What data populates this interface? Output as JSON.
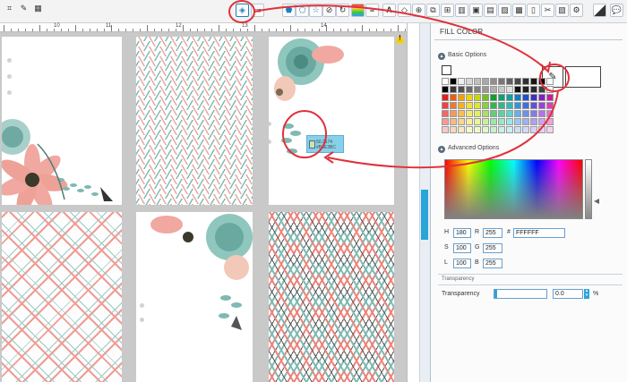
{
  "toolbar": {
    "icons": [
      "crop-tool-icon",
      "trace-tool-icon",
      "grid-tool-icon",
      "fill-color-icon",
      "line-color-icon",
      "pentagon-icon",
      "heptagon-icon",
      "star-icon",
      "knife-icon",
      "rotate-icon",
      "gradient-icon",
      "line-style-icon",
      "text-icon",
      "point-edit-icon",
      "offset-icon",
      "replicate-icon",
      "weld-icon",
      "align-icon",
      "group-icon",
      "image-icon",
      "library-icon",
      "store-icon",
      "page-setup-icon",
      "cut-settings-icon",
      "send-icon",
      "print-icon"
    ],
    "fill_icon_color": "#1f7ec2"
  },
  "ruler": {
    "top_labels": [
      "10",
      "11",
      "12",
      "13",
      "14"
    ]
  },
  "warning_symbol": "!",
  "tooltip": {
    "line1": "50.2174",
    "line2": "#B9E3BC"
  },
  "panel": {
    "title": "FILL COLOR",
    "basic_options_label": "Basic Options",
    "advanced_options_label": "Advanced Options",
    "transparency_section_label": "Transparency",
    "fields": {
      "h_label": "H",
      "h_value": "180",
      "s_label": "S",
      "s_value": "100",
      "l_label": "L",
      "l_value": "100",
      "r_label": "R",
      "r_value": "255",
      "g_label": "G",
      "g_value": "255",
      "b_label": "B",
      "b_value": "255",
      "hex_label": "#",
      "hex_value": "FFFFFF"
    },
    "transparency_label": "Transparency",
    "transparency_value": "0.0",
    "transparency_unit": "%"
  },
  "swatches": [
    "#ffffff",
    "#000000",
    "#f0f0f0",
    "#d8d8d8",
    "#c0c0c0",
    "#a8a8a8",
    "#909090",
    "#787878",
    "#606060",
    "#484848",
    "#303030",
    "#181818",
    "#0c0c0c",
    "#ffffff",
    "#000000",
    "#383838",
    "#505050",
    "#686868",
    "#808080",
    "#989898",
    "#b0b0b0",
    "#c8c8c8",
    "#e0e0e0",
    "#101010",
    "#202020",
    "#282828",
    "#404040",
    "#f8f8f8",
    "#e02020",
    "#f05a10",
    "#f5a000",
    "#f5d000",
    "#c8d800",
    "#70c020",
    "#10a030",
    "#10a070",
    "#10a0a0",
    "#1080c0",
    "#2050d0",
    "#4030c0",
    "#8020c0",
    "#c020a0",
    "#f04040",
    "#f07830",
    "#f8b020",
    "#f8e030",
    "#d8e830",
    "#88d040",
    "#30b850",
    "#30b888",
    "#30b8b8",
    "#3098d8",
    "#4070e0",
    "#6050d8",
    "#a040d8",
    "#d840b8",
    "#f06868",
    "#f89858",
    "#f8c050",
    "#f8e868",
    "#e0f060",
    "#a8e068",
    "#60d078",
    "#60d0a8",
    "#60d0d0",
    "#68b0e8",
    "#7090e8",
    "#8878e8",
    "#b870e8",
    "#e870d0",
    "#f89898",
    "#f8b888",
    "#f8d888",
    "#f8f098",
    "#e8f898",
    "#c8f098",
    "#98e8a8",
    "#98e8c8",
    "#98e8e8",
    "#98c8f0",
    "#a0b0f0",
    "#b0a0f0",
    "#d0a0f0",
    "#f0a0e0",
    "#f8c8c8",
    "#f8d8c0",
    "#f8e8c0",
    "#f8f8c8",
    "#f0f8c8",
    "#e0f8c8",
    "#c8f0d0",
    "#c8f0e0",
    "#c8f0f0",
    "#c8e0f8",
    "#d0d8f8",
    "#d8d0f8",
    "#e8d0f8",
    "#f8d0f0"
  ],
  "accent": "#e0303a"
}
